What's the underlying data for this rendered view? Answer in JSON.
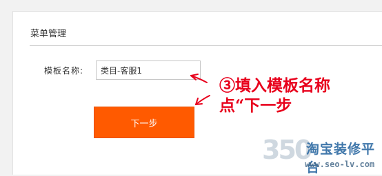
{
  "panel": {
    "title": "菜单管理"
  },
  "form": {
    "template_name_label": "模板名称:",
    "template_name_value": "类目-客服1"
  },
  "actions": {
    "next_label": "下一步"
  },
  "annotation": {
    "line1": "③填入模板名称",
    "line2": "点“下一步"
  },
  "watermark": {
    "number": "350",
    "brand": "淘宝装修平台",
    "url": "www.seo-lv.com"
  },
  "colors": {
    "accent_button": "#ff5a00",
    "annotation_red": "#e8001c",
    "brand_blue": "#2d6aa3"
  }
}
